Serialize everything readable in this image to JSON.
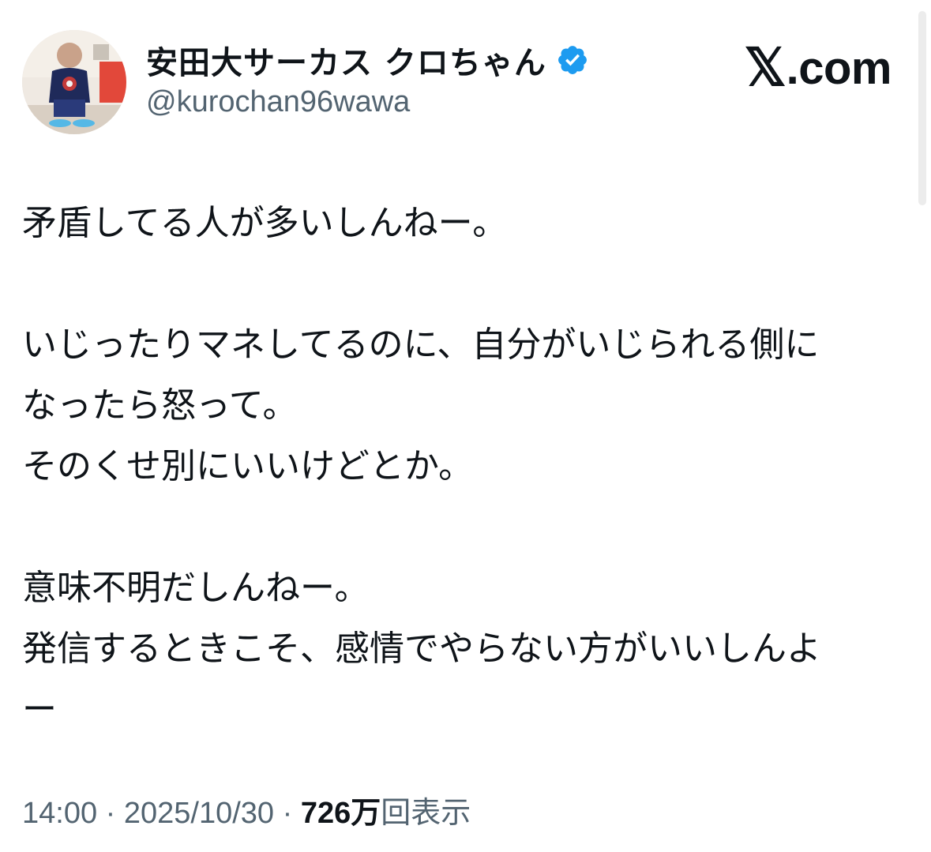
{
  "author": {
    "display_name": "安田大サーカス クロちゃん",
    "handle": "@kurochan96wawa",
    "verified_icon": "verified-badge-icon",
    "verified_color": "#1d9bf0"
  },
  "branding": {
    "logo_glyph": "𝕏",
    "logo_text": ".com"
  },
  "tweet": {
    "lines": [
      "矛盾してる人が多いしんねー。",
      "",
      "いじったりマネしてるのに、自分がいじられる側に",
      "なったら怒って。",
      "そのくせ別にいいけどとか。",
      "",
      "意味不明だしんねー。",
      "発信するときこそ、感情でやらない方がいいしんよ",
      "ー"
    ]
  },
  "meta": {
    "time": "14:00",
    "separator": " · ",
    "date": "2025/10/30",
    "views_count": "726万",
    "views_label": "回表示"
  },
  "colors": {
    "text_primary": "#0f1419",
    "text_secondary": "#536471",
    "background": "#ffffff"
  }
}
